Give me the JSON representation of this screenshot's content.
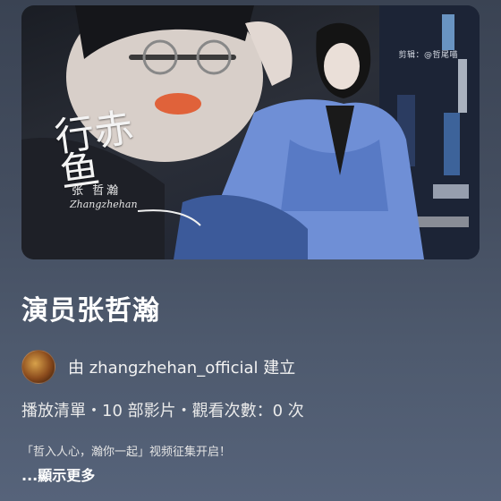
{
  "cover": {
    "credit": "剪辑：@哲尾喵",
    "title_art": "行赤鱼",
    "name": "张 哲瀚",
    "signature": "Zhangzhehan"
  },
  "playlist": {
    "title": "演员张哲瀚",
    "creator_line": "由 zhangzhehan_official 建立",
    "stats": "播放清單・10 部影片・觀看次數：0 次",
    "description": "「哲入人心，瀚你一起」视频征集开启！",
    "show_more": "...顯示更多"
  },
  "colors": {
    "background": "#444e60",
    "text": "#ffffff",
    "jacket": "#6f8fd6"
  }
}
